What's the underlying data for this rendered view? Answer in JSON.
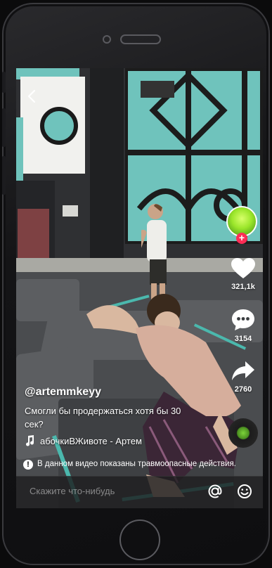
{
  "video": {
    "username": "@artemmkeyy",
    "caption": "Смогли бы продержаться хотя бы 30 сек?",
    "music": "абочкиВЖивоте - Артем"
  },
  "actions": {
    "likes": "321,1k",
    "comments": "3154",
    "shares": "2760"
  },
  "warning": {
    "text": "В данном видео показаны травмоопасные действия."
  },
  "comment_bar": {
    "placeholder": "Скажите что-нибудь"
  },
  "icons": [
    "back-arrow-icon",
    "heart-icon",
    "comment-icon",
    "share-icon",
    "music-note-icon",
    "warning-icon",
    "at-icon",
    "emoji-icon"
  ],
  "colors": {
    "accent": "#fe2c55",
    "wall_teal": "#6fc3bc"
  }
}
